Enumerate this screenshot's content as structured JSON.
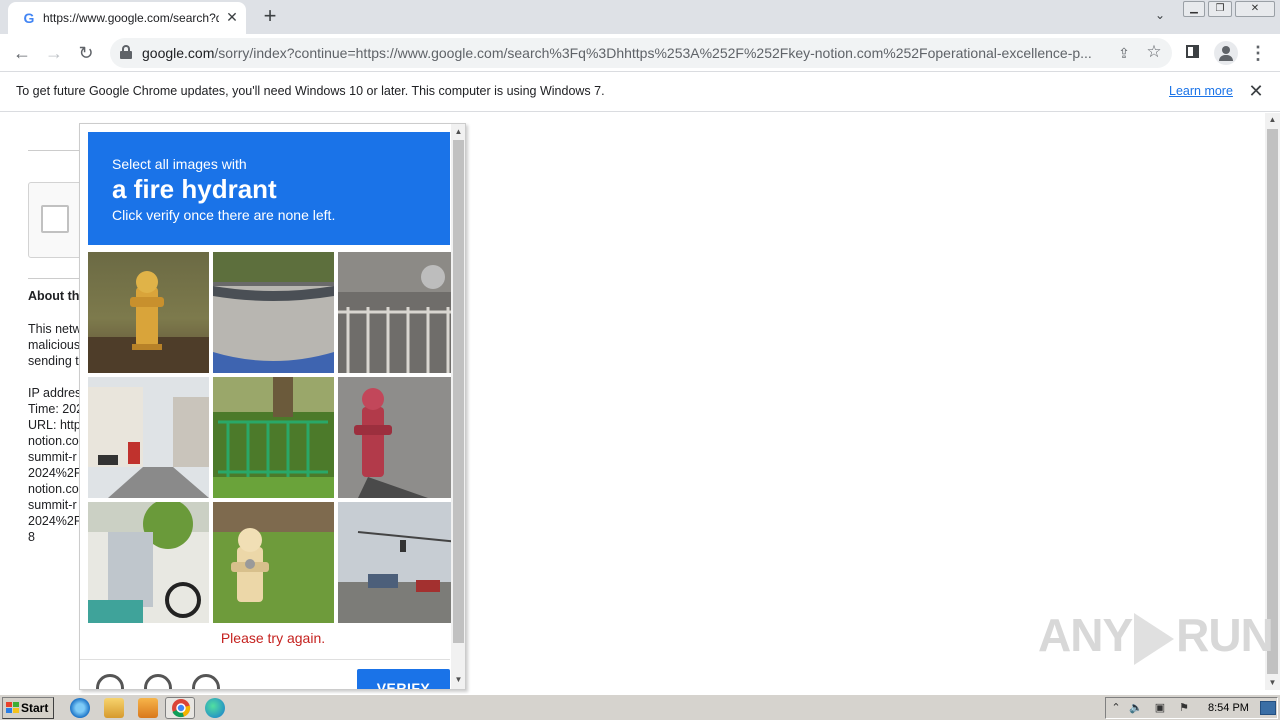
{
  "browser": {
    "tab_title": "https://www.google.com/search?q=",
    "tab_favicon": "G",
    "url_domain": "google.com",
    "url_rest": "/sorry/index?continue=https://www.google.com/search%3Fq%3Dhhttps%253A%252F%252Fkey-notion.com%252Foperational-excellence-p...",
    "icons": {
      "back": "arrow-left-icon",
      "forward": "arrow-right-icon",
      "reload": "reload-icon",
      "lock": "lock-icon",
      "share": "share-icon",
      "star": "star-icon",
      "side_panel": "side-panel-icon",
      "profile": "profile-icon",
      "menu": "kebab-menu-icon"
    }
  },
  "infobar": {
    "message": "To get future Google Chrome updates, you'll need Windows 10 or later. This computer is using Windows 7.",
    "learn_more": "Learn more"
  },
  "page": {
    "about_heading": "About th",
    "info_lines": "This netw\nmalicious\nsending t\n\nIP addres\nTime: 202\nURL: http\nnotion.co\nsummit-r\n2024%2F\nnotion.co\nsummit-r\n2024%2F\n8"
  },
  "captcha": {
    "instruction_line1": "Select all images with",
    "instruction_target": "a fire hydrant",
    "instruction_line3": "Click verify once there are none left.",
    "error_message": "Please try again.",
    "verify_label": "VERIFY",
    "accent_color": "#1a73e8",
    "error_color": "#c5221f",
    "tiles": [
      {
        "name": "tile-hydrant-yellow"
      },
      {
        "name": "tile-road-car"
      },
      {
        "name": "tile-car-fence"
      },
      {
        "name": "tile-street-buildings"
      },
      {
        "name": "tile-green-fence"
      },
      {
        "name": "tile-hydrant-red"
      },
      {
        "name": "tile-scooter-plant"
      },
      {
        "name": "tile-hydrant-cream"
      },
      {
        "name": "tile-intersection"
      }
    ]
  },
  "watermark": {
    "left": "ANY",
    "right": "RUN"
  },
  "taskbar": {
    "start_label": "Start",
    "clock": "8:54 PM"
  }
}
